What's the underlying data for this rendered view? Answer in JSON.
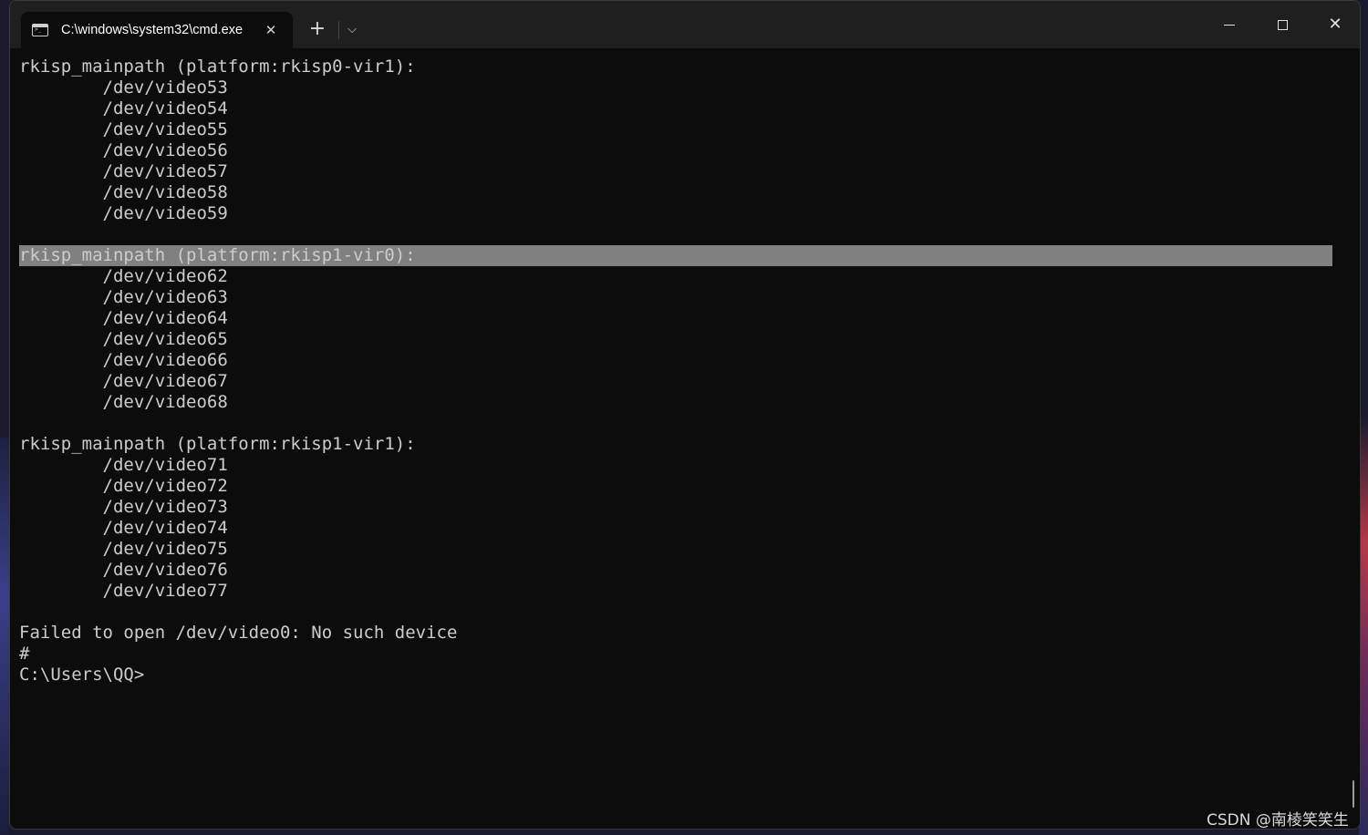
{
  "tab": {
    "title": "C:\\windows\\system32\\cmd.exe",
    "close_glyph": "✕"
  },
  "toolbar": {
    "new_tab_glyph": "+",
    "dropdown_glyph": "⌵"
  },
  "window_controls": {
    "close_glyph": "✕"
  },
  "console_lines": [
    "rkisp_mainpath (platform:rkisp0-vir1):",
    "        /dev/video53",
    "        /dev/video54",
    "        /dev/video55",
    "        /dev/video56",
    "        /dev/video57",
    "        /dev/video58",
    "        /dev/video59",
    "",
    "rkisp_mainpath (platform:rkisp1-vir0):",
    "        /dev/video62",
    "        /dev/video63",
    "        /dev/video64",
    "        /dev/video65",
    "        /dev/video66",
    "        /dev/video67",
    "        /dev/video68",
    "",
    "rkisp_mainpath (platform:rkisp1-vir1):",
    "        /dev/video71",
    "        /dev/video72",
    "        /dev/video73",
    "        /dev/video74",
    "        /dev/video75",
    "        /dev/video76",
    "        /dev/video77",
    "",
    "Failed to open /dev/video0: No such device",
    "#",
    "C:\\Users\\QQ>"
  ],
  "selected_line_index": 9,
  "watermark": "CSDN @南棱笑笑生",
  "colors": {
    "console_bg": "#0c0c0c",
    "console_text": "#cccccc",
    "selection": "#808080",
    "titlebar": "#1f1f1f"
  }
}
